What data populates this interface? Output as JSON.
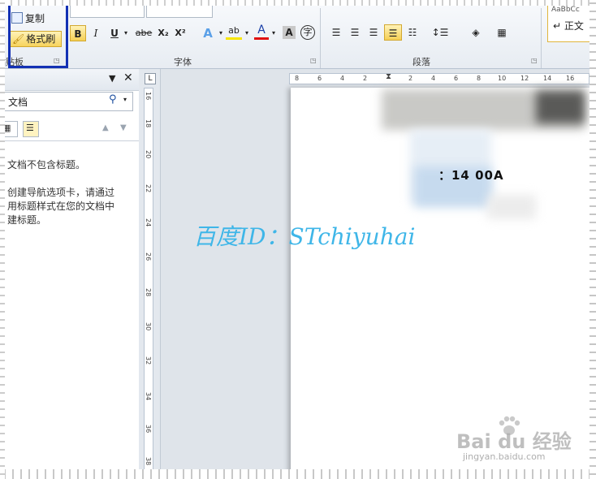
{
  "ribbon": {
    "clipboard": {
      "copy_label": "复制",
      "format_painter_label": "格式刷",
      "group_label": "粘贴板"
    },
    "font": {
      "group_label": "字体",
      "bold": "B",
      "italic": "I",
      "underline": "U",
      "strikethrough": "abe",
      "subscript": "X₂",
      "superscript": "X²",
      "text_effects": "A",
      "highlight": "ab",
      "font_color": "A",
      "char_shading": "A",
      "enclose_char": "字"
    },
    "paragraph": {
      "group_label": "段落"
    },
    "styles": {
      "sample_text": "AaBbCc",
      "normal_label": "↵ 正文"
    }
  },
  "nav_pane": {
    "search_text": "文档",
    "message": "文档不包含标题。\n\n创建导航选项卡，请通过用标题样式在您的文档中建标题。",
    "message_lines": [
      "文档不包含标题。",
      "",
      "创建导航选项卡，请通过",
      "用标题样式在您的文档中",
      "建标题。"
    ]
  },
  "rulers": {
    "tab_selector": "L",
    "horizontal_ticks": [
      "8",
      "6",
      "4",
      "2",
      "",
      "2",
      "4",
      "6",
      "8",
      "10",
      "12",
      "14",
      "16"
    ],
    "vertical_ticks": [
      "16",
      "18",
      "20",
      "22",
      "24",
      "26",
      "28",
      "30",
      "32",
      "34",
      "36",
      "38"
    ]
  },
  "document": {
    "visible_text": "：14   00A"
  },
  "watermark": {
    "id_text": "百度ID：STchiyuhai",
    "logo_text": "Bai du 经验",
    "url_text": "jingyan.baidu.com"
  },
  "colors": {
    "ribbon_bg": "#e7ecf2",
    "highlight_box": "#1230b4",
    "active_button": "#f5cf55",
    "watermark_blue": "#3fb6e8"
  }
}
